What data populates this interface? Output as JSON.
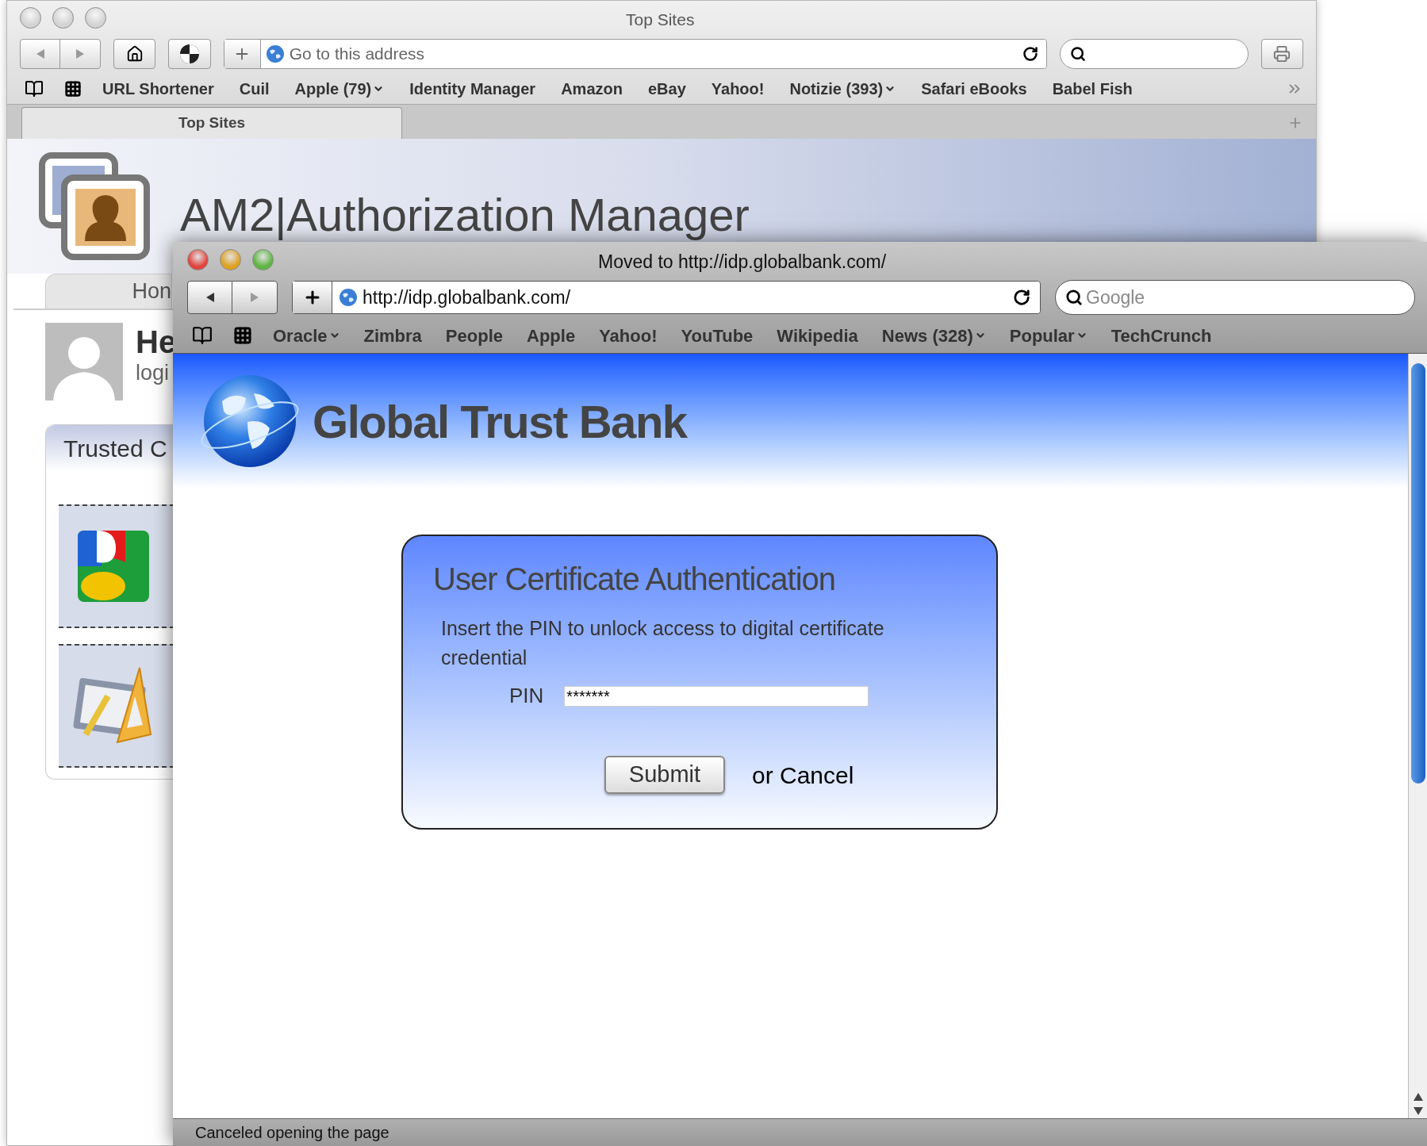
{
  "back_window": {
    "title": "Top Sites",
    "active": false,
    "address_placeholder": "Go to this address",
    "bookmarks": [
      {
        "label": "URL Shortener",
        "menu": false
      },
      {
        "label": "Cuil",
        "menu": false
      },
      {
        "label": "Apple (79)",
        "menu": true
      },
      {
        "label": "Identity Manager",
        "menu": false
      },
      {
        "label": "Amazon",
        "menu": false
      },
      {
        "label": "eBay",
        "menu": false
      },
      {
        "label": "Yahoo!",
        "menu": false
      },
      {
        "label": "Notizie (393)",
        "menu": true
      },
      {
        "label": "Safari eBooks",
        "menu": false
      },
      {
        "label": "Babel Fish",
        "menu": false
      }
    ],
    "tabs": [
      {
        "label": "Top Sites",
        "selected": true
      }
    ],
    "page": {
      "app_title": "AM2|Authorization Manager",
      "nav_tab": "Hon",
      "greeting": "He",
      "subtitle": "logi",
      "panel_title": "Trusted C"
    }
  },
  "front_window": {
    "title": "Moved to http://idp.globalbank.com/",
    "active": true,
    "address": "http://idp.globalbank.com/",
    "search_placeholder": "Google",
    "bookmarks": [
      {
        "label": "Oracle",
        "menu": true
      },
      {
        "label": "Zimbra",
        "menu": false
      },
      {
        "label": "People",
        "menu": false
      },
      {
        "label": "Apple",
        "menu": false
      },
      {
        "label": "Yahoo!",
        "menu": false
      },
      {
        "label": "YouTube",
        "menu": false
      },
      {
        "label": "Wikipedia",
        "menu": false
      },
      {
        "label": "News (328)",
        "menu": true
      },
      {
        "label": "Popular",
        "menu": true
      },
      {
        "label": "TechCrunch",
        "menu": false
      }
    ],
    "page": {
      "bank_name": "Global Trust Bank",
      "dialog": {
        "title": "User Certificate Authentication",
        "message": "Insert the PIN to unlock access to digital certificate credential",
        "pin_label": "PIN",
        "pin_value": "*******",
        "submit": "Submit",
        "cancel": "or Cancel"
      }
    },
    "status": "Canceled opening the page"
  }
}
